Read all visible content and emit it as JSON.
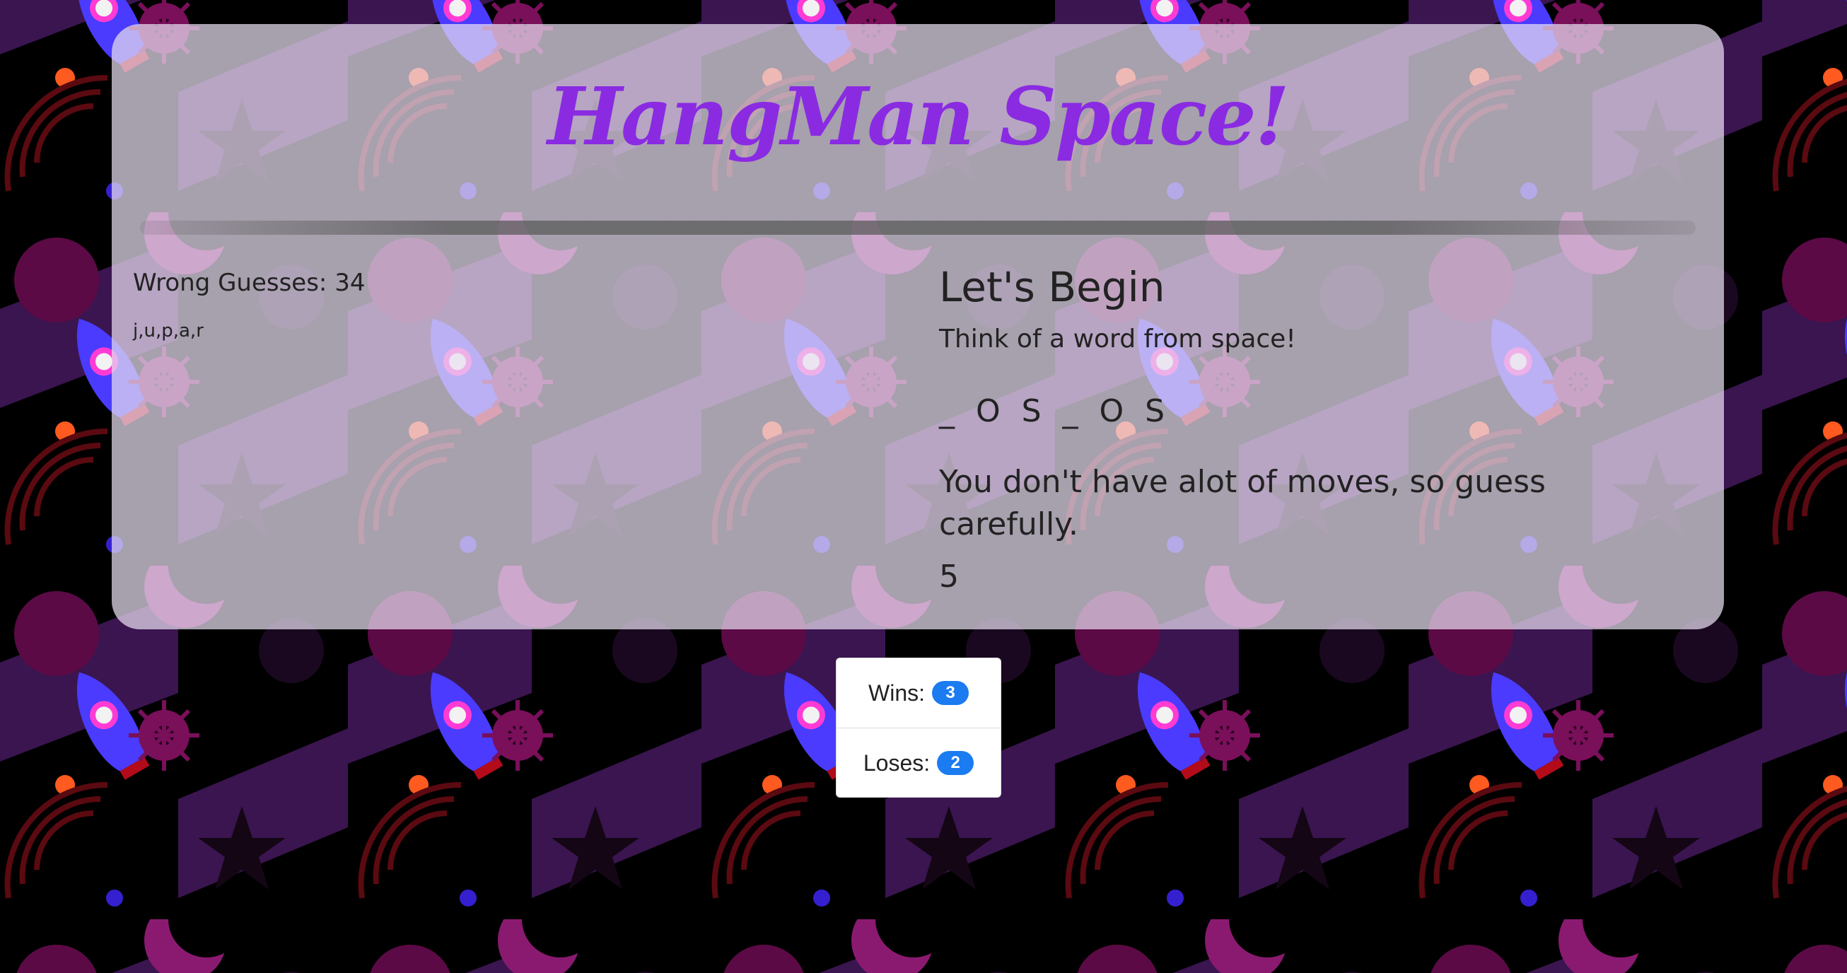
{
  "app": {
    "title": "HangMan Space!"
  },
  "wrong_guesses": {
    "label": "Wrong Guesses: 34",
    "letters": "j,u,p,a,r"
  },
  "game": {
    "heading": "Let's Begin",
    "prompt": "Think of a word from space!",
    "word_display": "_ O S _ O S",
    "warning": "You don't have alot of moves, so guess carefully.",
    "moves_left": "5"
  },
  "score": {
    "wins_label": "Wins:",
    "wins_value": "3",
    "loses_label": "Loses:",
    "loses_value": "2"
  },
  "colors": {
    "title": "#8a2be2",
    "badge": "#1a7cf0",
    "background": "#000000"
  },
  "icons": [
    "rocket-icon",
    "planet-icon",
    "star-icon",
    "sunburst-icon",
    "radar-icon"
  ]
}
